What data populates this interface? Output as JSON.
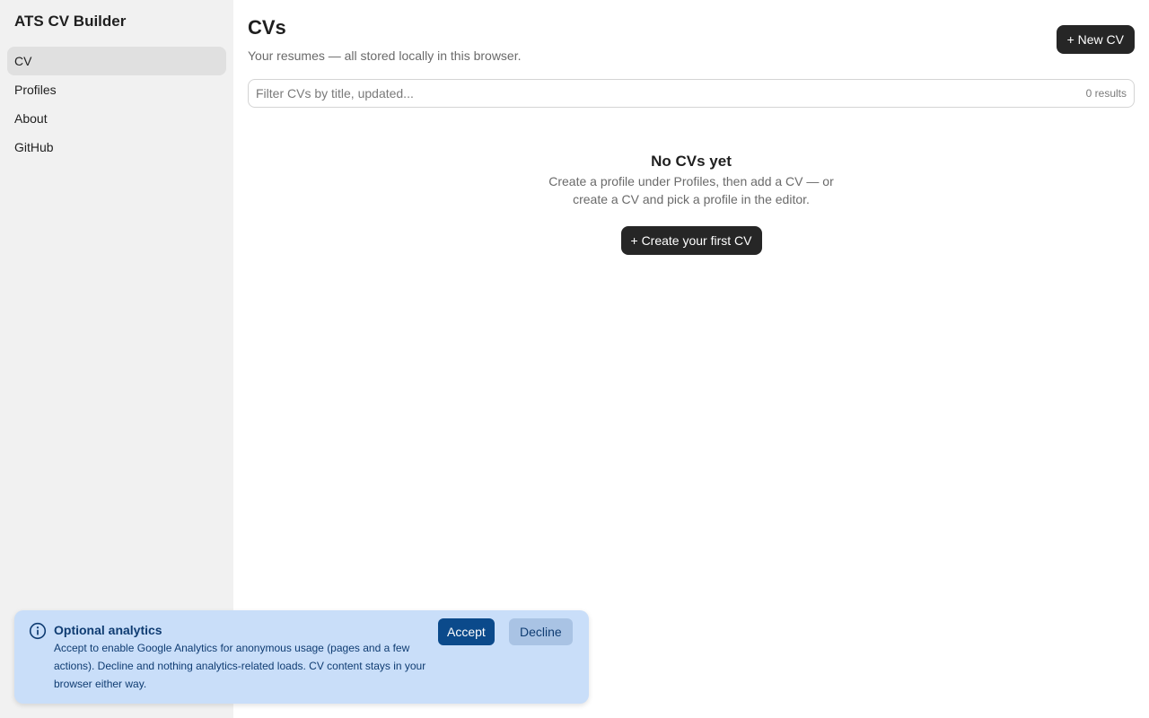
{
  "app": {
    "title": "ATS CV Builder"
  },
  "sidebar": {
    "items": [
      {
        "label": "CV",
        "active": true
      },
      {
        "label": "Profiles",
        "active": false
      },
      {
        "label": "About",
        "active": false
      },
      {
        "label": "GitHub",
        "active": false
      }
    ]
  },
  "header": {
    "title": "CVs",
    "subtitle": "Your resumes — all stored locally in this browser.",
    "new_button": "+ New CV"
  },
  "filter": {
    "placeholder": "Filter CVs by title, updated...",
    "value": "",
    "result_count": "0 results"
  },
  "empty_state": {
    "title": "No CVs yet",
    "description": "Create a profile under Profiles, then add a CV — or create a CV and pick a profile in the editor.",
    "button": "+ Create your first CV"
  },
  "analytics_banner": {
    "icon": "info-icon",
    "title": "Optional analytics",
    "text": "Accept to enable Google Analytics for anonymous usage (pages and a few actions). Decline and nothing analytics-related loads. CV content stays in your browser either way.",
    "accept": "Accept",
    "decline": "Decline"
  },
  "colors": {
    "sidebar_bg": "#f1f1f1",
    "active_nav_bg": "#e0e0e0",
    "dark_button": "#262626",
    "banner_bg": "#c9def9",
    "banner_text": "#0f3c72",
    "accept_button": "#0b4a8b",
    "decline_button": "#a9c3e4"
  }
}
